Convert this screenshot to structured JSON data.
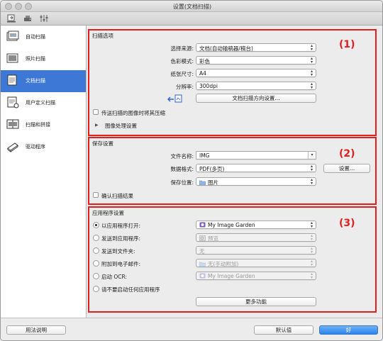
{
  "window": {
    "title": "设置(文档扫描)"
  },
  "toolbar": {
    "icons": [
      "scan-to-pc-icon",
      "general-settings-icon",
      "tools-icon"
    ]
  },
  "sidebar": {
    "items": [
      {
        "label": "自动扫描",
        "icon": "auto-scan-icon",
        "active": false
      },
      {
        "label": "照片扫描",
        "icon": "photo-scan-icon",
        "active": false
      },
      {
        "label": "文档扫描",
        "icon": "document-scan-icon",
        "active": true
      },
      {
        "label": "用户定义扫描",
        "icon": "custom-scan-icon",
        "active": false
      },
      {
        "label": "扫描和拼接",
        "icon": "scan-stitch-icon",
        "active": false
      },
      {
        "label": "驱动程序",
        "icon": "driver-icon",
        "active": false
      }
    ]
  },
  "scan_options": {
    "title": "扫描选项",
    "marker": "(1)",
    "source_label": "选择来源:",
    "source_value": "文档(自动输稿器/稿台)",
    "color_mode_label": "色彩模式:",
    "color_mode_value": "彩色",
    "paper_size_label": "纸张尺寸:",
    "paper_size_value": "A4",
    "resolution_label": "分辨率:",
    "resolution_value": "300dpi",
    "orientation_button": "文档扫描方向设置...",
    "compress_checkbox": "传送扫描的图像时将其压缩",
    "image_processing": "图像处理设置"
  },
  "save_settings": {
    "title": "保存设置",
    "marker": "(2)",
    "filename_label": "文件名称:",
    "filename_value": "IMG",
    "format_label": "数据格式:",
    "format_value": "PDF(多页)",
    "settings_button": "设置...",
    "location_label": "保存位置:",
    "location_value": "图片",
    "confirm_checkbox": "确认扫描结果"
  },
  "app_settings": {
    "title": "应用程序设置",
    "marker": "(3)",
    "options": [
      {
        "label": "以应用程序打开:",
        "value": "My Image Garden",
        "checked": true,
        "enabled": true
      },
      {
        "label": "发送到应用程序:",
        "value": "预览",
        "checked": false,
        "enabled": false
      },
      {
        "label": "发送到文件夹:",
        "value": "无",
        "checked": false,
        "enabled": false
      },
      {
        "label": "附加到电子邮件:",
        "value": "无(手动附加)",
        "checked": false,
        "enabled": false
      },
      {
        "label": "启动 OCR:",
        "value": "My Image Garden",
        "checked": false,
        "enabled": false
      },
      {
        "label": "请不要启动任何应用程序",
        "value": null,
        "checked": false,
        "enabled": true
      }
    ],
    "more_button": "更多功能"
  },
  "footer": {
    "help_button": "用法说明",
    "defaults_button": "默认值",
    "ok_button": "好"
  },
  "colors": {
    "accent": "#3e78d6",
    "highlight": "#e41d1d",
    "primary_button": "#2a84ee"
  }
}
